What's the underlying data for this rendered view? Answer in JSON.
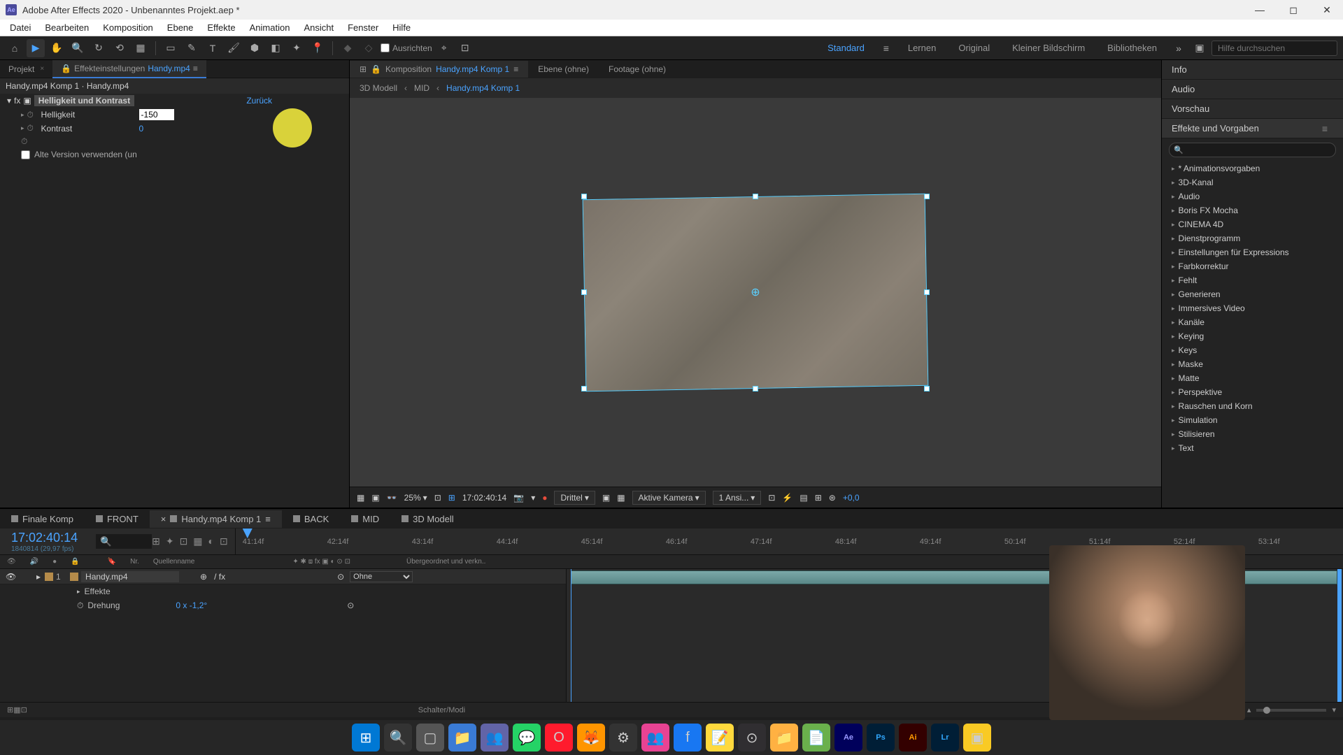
{
  "titlebar": {
    "title": "Adobe After Effects 2020 - Unbenanntes Projekt.aep *"
  },
  "menubar": [
    "Datei",
    "Bearbeiten",
    "Komposition",
    "Ebene",
    "Effekte",
    "Animation",
    "Ansicht",
    "Fenster",
    "Hilfe"
  ],
  "toolbar": {
    "align": "Ausrichten",
    "workspace_active": "Standard",
    "workspaces": [
      "Lernen",
      "Original",
      "Kleiner Bildschirm",
      "Bibliotheken"
    ],
    "search_placeholder": "Hilfe durchsuchen"
  },
  "left_panel": {
    "tabs": {
      "project": "Projekt",
      "effect_controls": "Effekteinstellungen",
      "comp_name": "Handy.mp4"
    },
    "breadcrumb": "Handy.mp4 Komp 1 · Handy.mp4",
    "effect": {
      "name": "Helligkeit und Kontrast",
      "reset": "Zurück",
      "prop1_label": "Helligkeit",
      "prop1_value": "-150",
      "prop2_label": "Kontrast",
      "prop2_value": "0",
      "checkbox_label": "Alte Version verwenden (un"
    }
  },
  "comp_panel": {
    "tabs": {
      "composition": "Komposition",
      "comp_name": "Handy.mp4 Komp 1",
      "layer": "Ebene (ohne)",
      "footage": "Footage (ohne)"
    },
    "breadcrumb": [
      "3D Modell",
      "MID",
      "Handy.mp4 Komp 1"
    ]
  },
  "viewer_footer": {
    "zoom": "25%",
    "timecode": "17:02:40:14",
    "resolution": "Drittel",
    "camera": "Aktive Kamera",
    "views": "1 Ansi...",
    "exposure": "+0,0"
  },
  "right_panel": {
    "tabs": [
      "Info",
      "Audio",
      "Vorschau"
    ],
    "effects_tab": "Effekte und Vorgaben",
    "presets": [
      "* Animationsvorgaben",
      "3D-Kanal",
      "Audio",
      "Boris FX Mocha",
      "CINEMA 4D",
      "Dienstprogramm",
      "Einstellungen für Expressions",
      "Farbkorrektur",
      "Fehlt",
      "Generieren",
      "Immersives Video",
      "Kanäle",
      "Keying",
      "Keys",
      "Maske",
      "Matte",
      "Perspektive",
      "Rauschen und Korn",
      "Simulation",
      "Stilisieren",
      "Text"
    ]
  },
  "timeline": {
    "tabs": [
      "Finale Komp",
      "FRONT",
      "Handy.mp4 Komp 1",
      "BACK",
      "MID",
      "3D Modell"
    ],
    "active_tab": 2,
    "timecode": "17:02:40:14",
    "frame_info": "1840814 (29,97 fps)",
    "ruler": [
      "41:14f",
      "42:14f",
      "43:14f",
      "44:14f",
      "45:14f",
      "46:14f",
      "47:14f",
      "48:14f",
      "49:14f",
      "50:14f",
      "51:14f",
      "52:14f",
      "53:14f"
    ],
    "columns": {
      "nr": "Nr.",
      "source": "Quellenname",
      "parent": "Übergeordnet und verkn..",
      "none": "Ohne"
    },
    "layer": {
      "num": "1",
      "name": "Handy.mp4",
      "effects_label": "Effekte",
      "rotation_label": "Drehung",
      "rotation_value": "0 x -1,2°"
    },
    "footer": "Schalter/Modi"
  }
}
